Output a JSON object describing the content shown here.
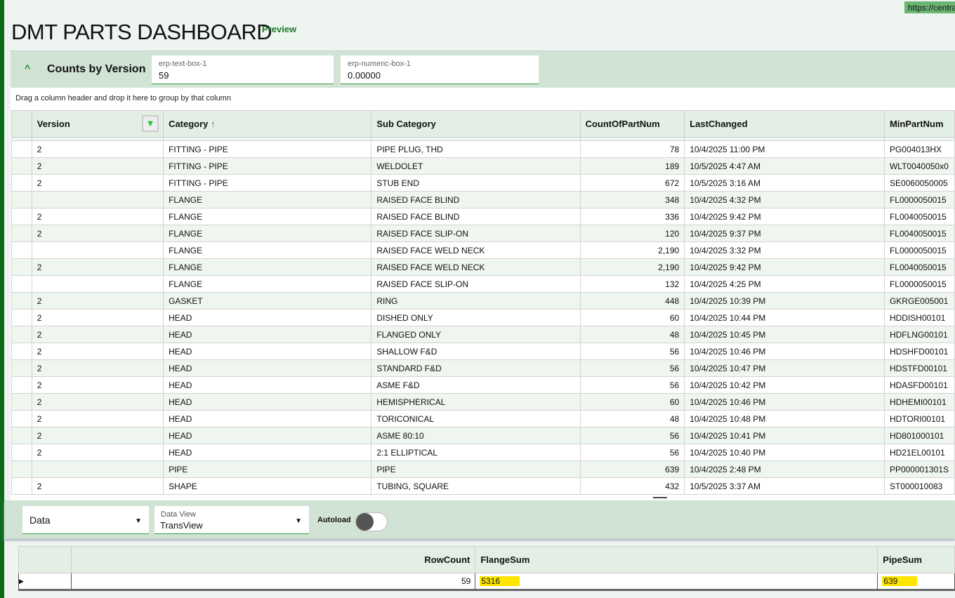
{
  "url": "https://centra",
  "title": "DMT PARTS DASHBOARD",
  "badge": "Preview",
  "panel": {
    "title": "Counts by Version",
    "text_box": {
      "label": "erp-text-box-1",
      "value": "59"
    },
    "numeric_box": {
      "label": "erp-numeric-box-1",
      "value": "0.00000"
    }
  },
  "grid": {
    "group_hint": "Drag a column header and drop it here to group by that column",
    "columns": [
      "Version",
      "Category",
      "Sub Category",
      "CountOfPartNum",
      "LastChanged",
      "MinPartNum"
    ],
    "sort": {
      "column": "Category",
      "direction": "ascending"
    },
    "rows": [
      [
        "2",
        "FITTING - PIPE",
        "PIPE PLUG, THD",
        "78",
        "10/4/2025 11:00 PM",
        "PG004013HX"
      ],
      [
        "2",
        "FITTING - PIPE",
        "WELDOLET",
        "189",
        "10/5/2025 4:47 AM",
        "WLT0040050x0"
      ],
      [
        "2",
        "FITTING - PIPE",
        "STUB END",
        "672",
        "10/5/2025 3:16 AM",
        "SE0060050005"
      ],
      [
        "",
        "FLANGE",
        "RAISED FACE BLIND",
        "348",
        "10/4/2025 4:32 PM",
        "FL0000050015"
      ],
      [
        "2",
        "FLANGE",
        "RAISED FACE BLIND",
        "336",
        "10/4/2025 9:42 PM",
        "FL0040050015"
      ],
      [
        "2",
        "FLANGE",
        "RAISED FACE SLIP-ON",
        "120",
        "10/4/2025 9:37 PM",
        "FL0040050015"
      ],
      [
        "",
        "FLANGE",
        "RAISED FACE WELD NECK",
        "2,190",
        "10/4/2025 3:32 PM",
        "FL0000050015"
      ],
      [
        "2",
        "FLANGE",
        "RAISED FACE WELD NECK",
        "2,190",
        "10/4/2025 9:42 PM",
        "FL0040050015"
      ],
      [
        "",
        "FLANGE",
        "RAISED FACE SLIP-ON",
        "132",
        "10/4/2025 4:25 PM",
        "FL0000050015"
      ],
      [
        "2",
        "GASKET",
        "RING",
        "448",
        "10/4/2025 10:39 PM",
        "GKRGE005001"
      ],
      [
        "2",
        "HEAD",
        "DISHED ONLY",
        "60",
        "10/4/2025 10:44 PM",
        "HDDISH00101"
      ],
      [
        "2",
        "HEAD",
        "FLANGED ONLY",
        "48",
        "10/4/2025 10:45 PM",
        "HDFLNG00101"
      ],
      [
        "2",
        "HEAD",
        "SHALLOW F&D",
        "56",
        "10/4/2025 10:46 PM",
        "HDSHFD00101"
      ],
      [
        "2",
        "HEAD",
        "STANDARD F&D",
        "56",
        "10/4/2025 10:47 PM",
        "HDSTFD00101"
      ],
      [
        "2",
        "HEAD",
        "ASME F&D",
        "56",
        "10/4/2025 10:42 PM",
        "HDASFD00101"
      ],
      [
        "2",
        "HEAD",
        "HEMISPHERICAL",
        "60",
        "10/4/2025 10:46 PM",
        "HDHEMI00101"
      ],
      [
        "2",
        "HEAD",
        "TORICONICAL",
        "48",
        "10/4/2025 10:48 PM",
        "HDTORI00101"
      ],
      [
        "2",
        "HEAD",
        "ASME 80:10",
        "56",
        "10/4/2025 10:41 PM",
        "HD801000101"
      ],
      [
        "2",
        "HEAD",
        "2:1 ELLIPTICAL",
        "56",
        "10/4/2025 10:40 PM",
        "HD21EL00101"
      ],
      [
        "",
        "PIPE",
        "PIPE",
        "639",
        "10/4/2025 2:48 PM",
        "PP000001301S"
      ],
      [
        "2",
        "SHAPE",
        "TUBING, SQUARE",
        "432",
        "10/5/2025 3:37 AM",
        "ST000010083"
      ]
    ]
  },
  "toolbar": {
    "data_select": "Data",
    "data_view": {
      "label": "Data View",
      "value": "TransView"
    },
    "autoload": {
      "label": "Autoload",
      "on": false
    }
  },
  "summary": {
    "columns": [
      "RowCount",
      "FlangeSum",
      "PipeSum"
    ],
    "values": [
      "59",
      "5316",
      "639"
    ],
    "highlight_color": "#ffe600"
  }
}
